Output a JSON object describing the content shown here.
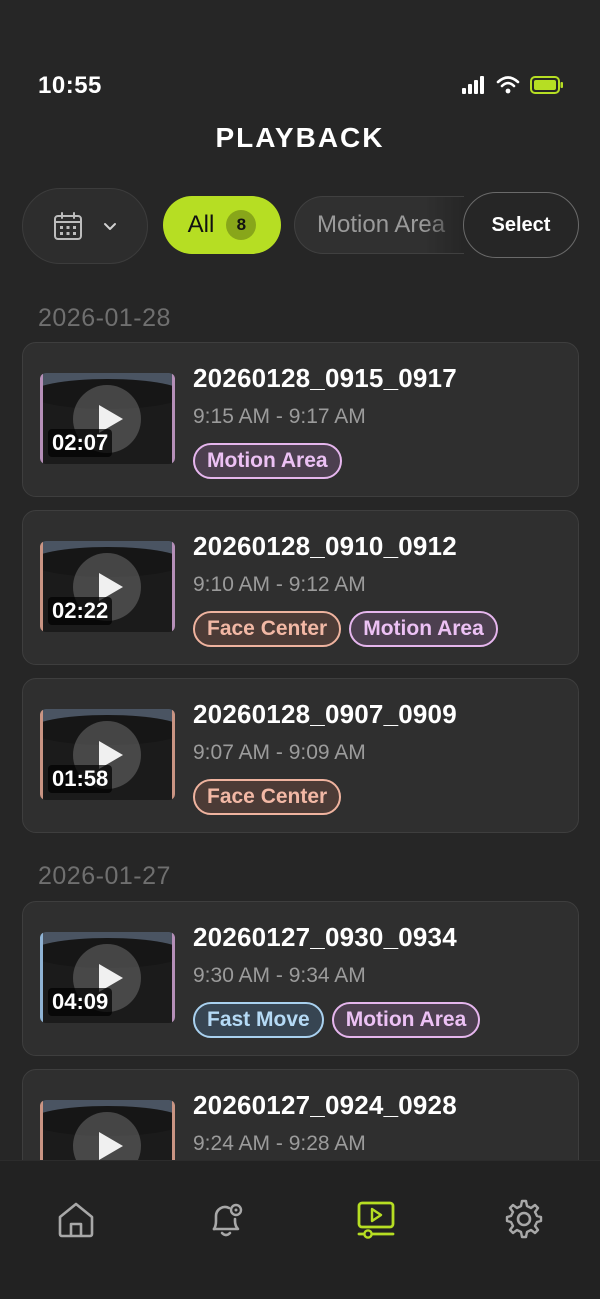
{
  "status_bar": {
    "time": "10:55"
  },
  "header": {
    "title": "PLAYBACK"
  },
  "filters": {
    "chips": [
      {
        "label": "All",
        "count": "8"
      },
      {
        "label": "Motion Area"
      }
    ],
    "select_label": "Select"
  },
  "groups": [
    {
      "date": "2026-01-28",
      "clips": [
        {
          "title": "20260128_0915_0917",
          "time": "9:15 AM - 9:17 AM",
          "duration": "02:07",
          "tags": [
            "Motion Area"
          ]
        },
        {
          "title": "20260128_0910_0912",
          "time": "9:10 AM - 9:12 AM",
          "duration": "02:22",
          "tags": [
            "Face Center",
            "Motion Area"
          ]
        },
        {
          "title": "20260128_0907_0909",
          "time": "9:07 AM - 9:09 AM",
          "duration": "01:58",
          "tags": [
            "Face Center"
          ]
        }
      ]
    },
    {
      "date": "2026-01-27",
      "clips": [
        {
          "title": "20260127_0930_0934",
          "time": "9:30 AM - 9:34 AM",
          "duration": "04:09",
          "tags": [
            "Fast Move",
            "Motion Area"
          ]
        },
        {
          "title": "20260127_0924_0928",
          "time": "9:24 AM - 9:28 AM",
          "duration": "",
          "tags": []
        }
      ]
    }
  ],
  "nav": {
    "items": [
      {
        "icon": "home-icon"
      },
      {
        "icon": "bell-alert-icon"
      },
      {
        "icon": "playback-icon",
        "active": true
      },
      {
        "icon": "gear-icon"
      }
    ]
  },
  "colors": {
    "accent": "#b6de23",
    "motion_area": "#e6b6ee",
    "face_center": "#efb39f",
    "fast_move": "#a9d1ef"
  }
}
